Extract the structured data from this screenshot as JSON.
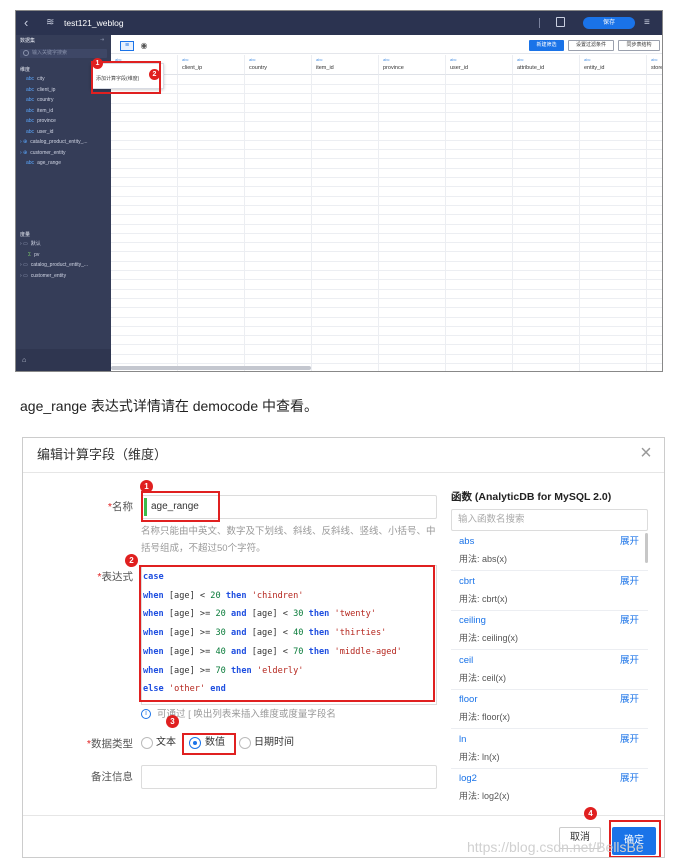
{
  "shot1": {
    "dataset_title": "test121_weblog",
    "save_label": "保存",
    "sidebar": {
      "section_dataset": "数据集",
      "search_placeholder": "输入关键字搜索",
      "section_dimension": "维度",
      "dimensions": [
        "city",
        "client_ip",
        "country",
        "item_id",
        "province",
        "user_id"
      ],
      "groups": [
        "catalog_product_entity_...",
        "customer_entity"
      ],
      "calc_field": "age_range",
      "section_measure": "度量",
      "measure_groups": [
        "默认",
        "pv",
        "catalog_product_entity_...",
        "customer_entity"
      ]
    },
    "context_menu_item": "添加计算字段(维度)",
    "toolbar": {
      "new_filter": "新建筛选",
      "set_filter": "设置过滤条件",
      "sync": "同步表结构"
    },
    "columns": [
      "city",
      "client_ip",
      "country",
      "item_id",
      "province",
      "user_id",
      "attribute_id",
      "entity_id",
      "store"
    ],
    "col_type_tag": "abc",
    "badges": [
      "1",
      "2"
    ]
  },
  "caption": "age_range 表达式详情请在 democode 中查看。",
  "dialog": {
    "title": "编辑计算字段（维度）",
    "name_label": "名称",
    "name_value": "age_range",
    "name_hint": "名称只能由中英文、数字及下划线、斜线、反斜线、竖线、小括号、中括号组成，不超过50个字符。",
    "expr_label": "表达式",
    "code": [
      {
        "parts": [
          [
            "kw",
            "case"
          ]
        ]
      },
      {
        "parts": [
          [
            "kw",
            "when"
          ],
          [
            "op",
            " [age] < "
          ],
          [
            "num",
            "20"
          ],
          [
            "op",
            " "
          ],
          [
            "kw",
            "then"
          ],
          [
            "op",
            " "
          ],
          [
            "str",
            "'chindren'"
          ]
        ]
      },
      {
        "parts": [
          [
            "kw",
            "when"
          ],
          [
            "op",
            " [age] >= "
          ],
          [
            "num",
            "20"
          ],
          [
            "op",
            " "
          ],
          [
            "kw",
            "and"
          ],
          [
            "op",
            " [age] < "
          ],
          [
            "num",
            "30"
          ],
          [
            "op",
            " "
          ],
          [
            "kw",
            "then"
          ],
          [
            "op",
            " "
          ],
          [
            "str",
            "'twenty'"
          ]
        ]
      },
      {
        "parts": [
          [
            "kw",
            "when"
          ],
          [
            "op",
            " [age] >= "
          ],
          [
            "num",
            "30"
          ],
          [
            "op",
            " "
          ],
          [
            "kw",
            "and"
          ],
          [
            "op",
            " [age] < "
          ],
          [
            "num",
            "40"
          ],
          [
            "op",
            " "
          ],
          [
            "kw",
            "then"
          ],
          [
            "op",
            " "
          ],
          [
            "str",
            "'thirties'"
          ]
        ]
      },
      {
        "parts": [
          [
            "kw",
            "when"
          ],
          [
            "op",
            " [age] >= "
          ],
          [
            "num",
            "40"
          ],
          [
            "op",
            " "
          ],
          [
            "kw",
            "and"
          ],
          [
            "op",
            " [age] < "
          ],
          [
            "num",
            "70"
          ],
          [
            "op",
            " "
          ],
          [
            "kw",
            "then"
          ],
          [
            "op",
            " "
          ],
          [
            "str",
            "'middle-aged'"
          ]
        ]
      },
      {
        "parts": [
          [
            "kw",
            "when"
          ],
          [
            "op",
            " [age] >= "
          ],
          [
            "num",
            "70"
          ],
          [
            "op",
            " "
          ],
          [
            "kw",
            "then"
          ],
          [
            "op",
            " "
          ],
          [
            "str",
            "'elderly'"
          ]
        ]
      },
      {
        "parts": [
          [
            "kw",
            "else"
          ],
          [
            "op",
            " "
          ],
          [
            "str",
            "'other'"
          ],
          [
            "op",
            " "
          ],
          [
            "kw",
            "end"
          ]
        ]
      }
    ],
    "expr_hint": "可通过 [ 唤出列表来插入维度或度量字段名",
    "type_label": "数据类型",
    "types": [
      "文本",
      "数值",
      "日期时间"
    ],
    "selected_type": "数值",
    "note_label": "备注信息",
    "fn_title": "函数 (AnalyticDB for MySQL 2.0)",
    "fn_search_placeholder": "输入函数名搜索",
    "expand_label": "展开",
    "usage_prefix": "用法: ",
    "functions": [
      {
        "name": "abs",
        "usage": "abs(x)"
      },
      {
        "name": "cbrt",
        "usage": "cbrt(x)"
      },
      {
        "name": "ceiling",
        "usage": "ceiling(x)"
      },
      {
        "name": "ceil",
        "usage": "ceil(x)"
      },
      {
        "name": "floor",
        "usage": "floor(x)"
      },
      {
        "name": "ln",
        "usage": "ln(x)"
      },
      {
        "name": "log2",
        "usage": "log2(x)"
      }
    ],
    "cancel_label": "取消",
    "ok_label": "确定",
    "badges": [
      "1",
      "2",
      "3",
      "4"
    ]
  },
  "watermark": "https://blog.csdn.net/BellsBe",
  "colors": {
    "accent": "#1a73e8",
    "highlight_red": "#e02020",
    "sidebar_bg": "#353d58",
    "topbar_bg": "#2b3350"
  }
}
